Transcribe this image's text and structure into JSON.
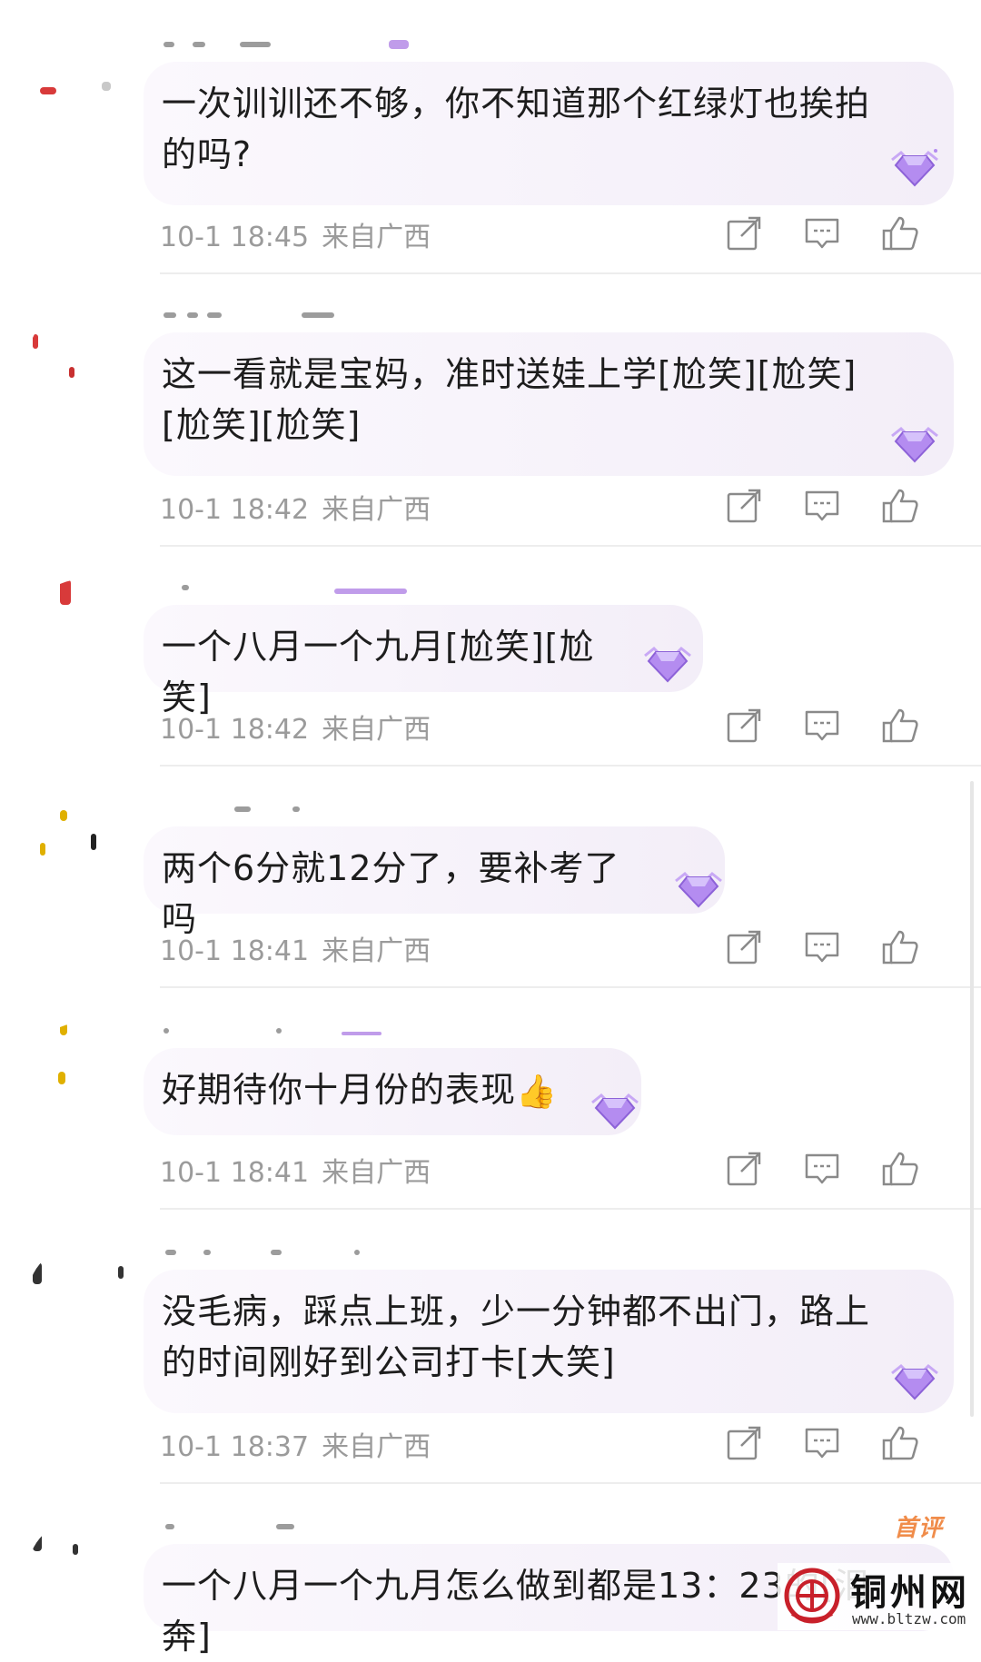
{
  "colors": {
    "meta_text": "#9b9b9b",
    "bubble_bg": "#f3eef8",
    "gem": "#b48cf0",
    "icon_stroke": "#8a8a8a",
    "first_tag": "#f08c4a",
    "watermark_red": "#c8202a"
  },
  "icons": {
    "share": "share-icon",
    "reply": "comment-icon",
    "like": "thumbs-up-icon",
    "badge": "gem-badge-icon"
  },
  "comments": [
    {
      "text": "一次训训还不够，你不知道那个红绿灯也挨拍的吗?",
      "time": "10-1 18:45",
      "location": "来自广西"
    },
    {
      "text": "这一看就是宝妈，准时送娃上学[尬笑][尬笑][尬笑][尬笑]",
      "time": "10-1 18:42",
      "location": "来自广西"
    },
    {
      "text": "一个八月一个九月[尬笑][尬笑]",
      "time": "10-1 18:42",
      "location": "来自广西"
    },
    {
      "text": "两个6分就12分了，要补考了吗",
      "time": "10-1 18:41",
      "location": "来自广西"
    },
    {
      "text": "好期待你十月份的表现",
      "time": "10-1 18:41",
      "location": "来自广西"
    },
    {
      "text": "没毛病，踩点上班，少一分钟都不出门，路上的时间刚好到公司打卡[大笑]",
      "time": "10-1 18:37",
      "location": "来自广西"
    },
    {
      "text": "一个八月一个九月怎么做到都是13：23的[泪奔]",
      "first_tag": "首评"
    }
  ],
  "watermark": {
    "title": "铜州网",
    "url": "www.bltzw.com"
  }
}
